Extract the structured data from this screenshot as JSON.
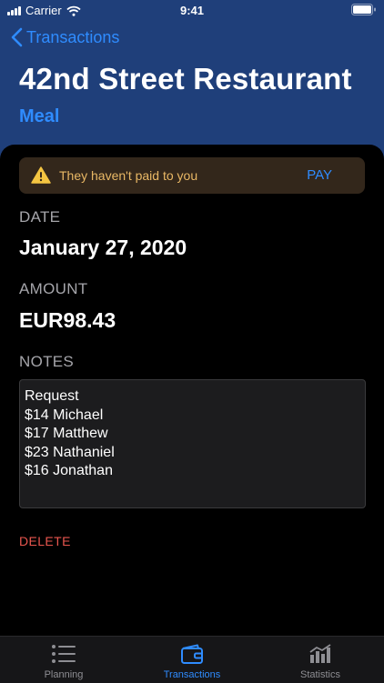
{
  "status_bar": {
    "carrier": "Carrier",
    "time": "9:41"
  },
  "nav": {
    "back_label": "Transactions"
  },
  "transaction": {
    "title": "42nd Street Restaurant",
    "category": "Meal",
    "alert": {
      "message": "They haven't paid to you",
      "action": "PAY"
    },
    "date_label": "DATE",
    "date_value": "January 27, 2020",
    "amount_label": "AMOUNT",
    "amount_value": "EUR98.43",
    "notes_label": "NOTES",
    "notes_value": "Request\n$14 Michael\n$17 Matthew\n$23 Nathaniel\n$16 Jonathan",
    "delete_label": "DELETE"
  },
  "tabs": [
    {
      "label": "Planning",
      "icon": "list-icon",
      "active": false
    },
    {
      "label": "Transactions",
      "icon": "wallet-icon",
      "active": true
    },
    {
      "label": "Statistics",
      "icon": "bar-chart-icon",
      "active": false
    }
  ],
  "colors": {
    "header_bg": "#1f3f7a",
    "accent": "#2f8cff",
    "warning": "#e9b865",
    "destructive": "#e8564e"
  }
}
